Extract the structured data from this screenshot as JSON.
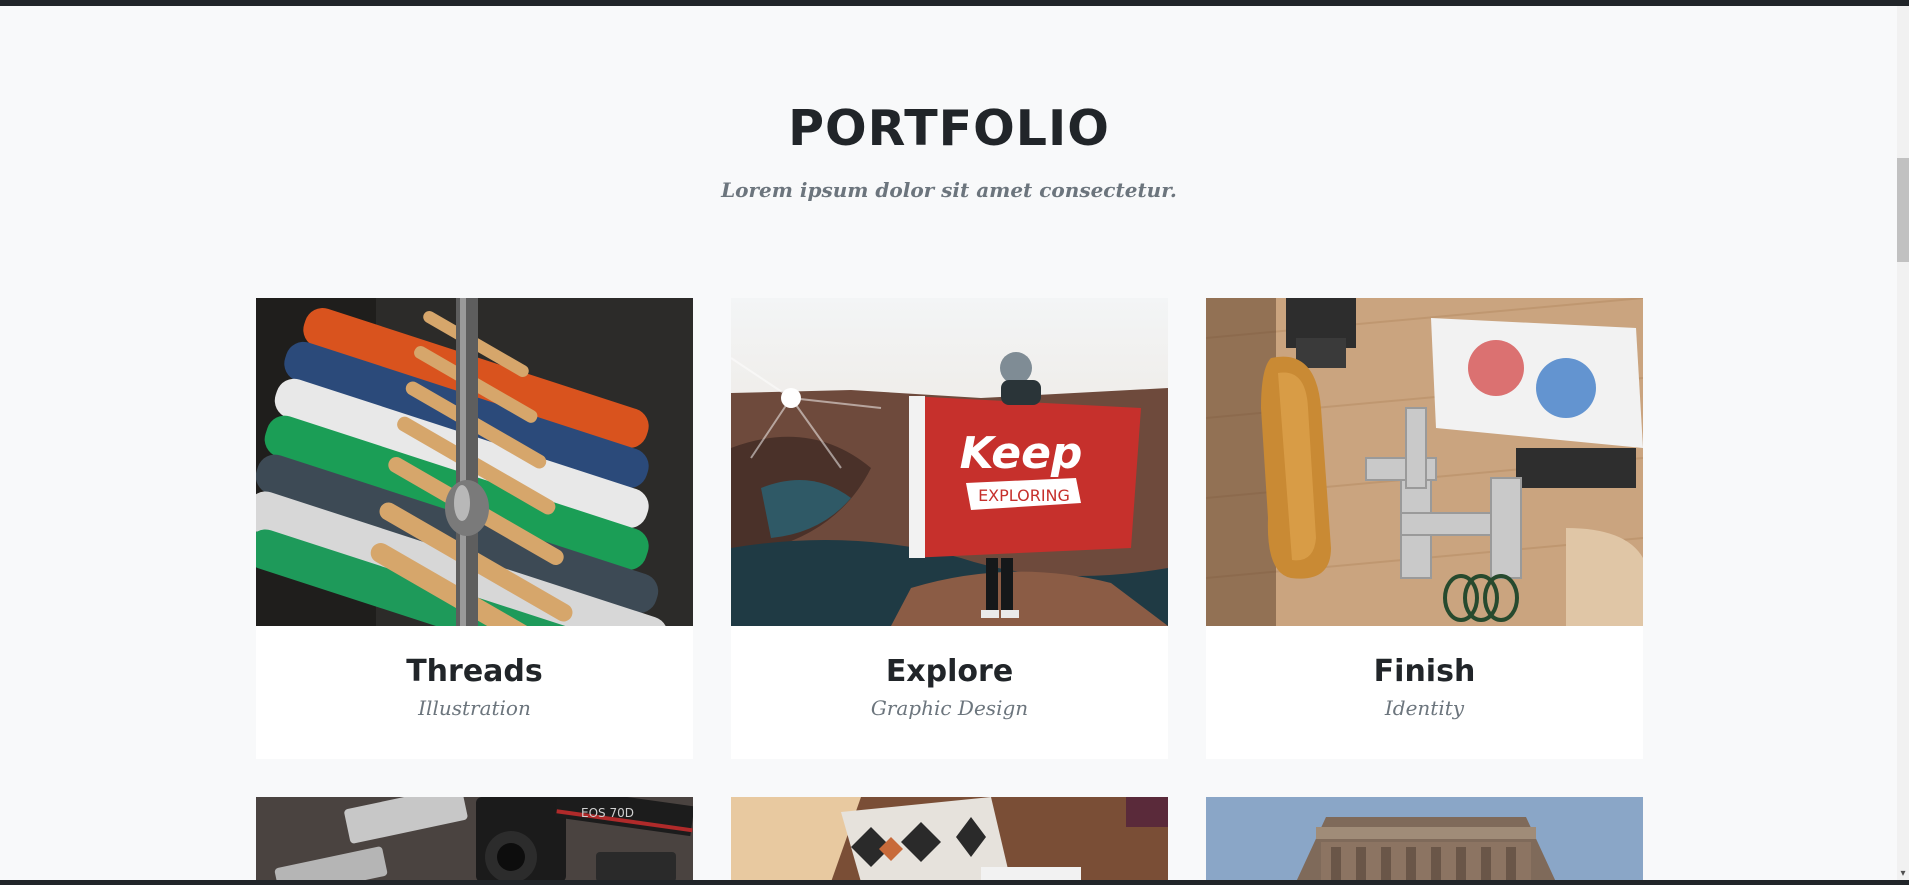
{
  "portfolio": {
    "heading": "PORTFOLIO",
    "subheading": "Lorem ipsum dolor sit amet consectetur.",
    "items": [
      {
        "title": "Threads",
        "category": "Illustration"
      },
      {
        "title": "Explore",
        "category": "Graphic Design"
      },
      {
        "title": "Finish",
        "category": "Identity"
      }
    ]
  },
  "images": {
    "explore_flag_text_1": "Keep",
    "explore_flag_text_2": "EXPLORING",
    "camera_text": "EOS 70D"
  },
  "colors": {
    "background": "#f8f9fa",
    "heading": "#212529",
    "muted": "#6c757d",
    "card": "#ffffff"
  }
}
